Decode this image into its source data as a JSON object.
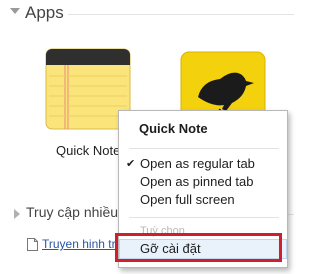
{
  "apps_section": {
    "title": "Apps"
  },
  "apps": [
    {
      "label": "Quick Note",
      "icon": "notepad-icon"
    },
    {
      "label": "",
      "icon": "bird-icon"
    }
  ],
  "section2": {
    "title": "Truy cập nhiều"
  },
  "links": [
    {
      "label": "Truyen hinh tr",
      "icon": "document-icon"
    }
  ],
  "context_menu": {
    "header": "Quick Note",
    "items": [
      {
        "label": "Open as regular tab",
        "checked": true
      },
      {
        "label": "Open as pinned tab",
        "checked": false
      },
      {
        "label": "Open full screen",
        "checked": false
      }
    ],
    "options_label": "Tuỳ chọn",
    "uninstall_label": "Gỡ cài đặt"
  },
  "colors": {
    "highlight_border": "#cf1f2a",
    "link": "#2a55a8",
    "selected_bg": "#e9f1fb"
  }
}
